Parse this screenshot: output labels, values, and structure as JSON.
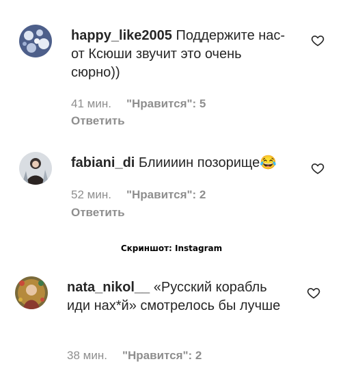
{
  "comments": [
    {
      "username": "happy_like2005",
      "text": "Поддержите нас- от Ксюши звучит это очень сюрно))",
      "time": "41 мин.",
      "likes": "\"Нравится\": 5",
      "reply": "Ответить"
    },
    {
      "username": "fabiani_di",
      "text": "Блиииин позорище😂",
      "time": "52 мин.",
      "likes": "\"Нравится\": 2",
      "reply": "Ответить"
    },
    {
      "username": "nata_nikol__",
      "text": "«Русский корабль иди нах*й» смотрелось бы лучше",
      "time": "38 мин.",
      "likes": "\"Нравится\": 2"
    }
  ],
  "caption": "Скриншот: Instagram",
  "colors": {
    "text": "#262626",
    "meta": "#8e8e8e"
  },
  "icons": {
    "like": "heart-icon"
  }
}
